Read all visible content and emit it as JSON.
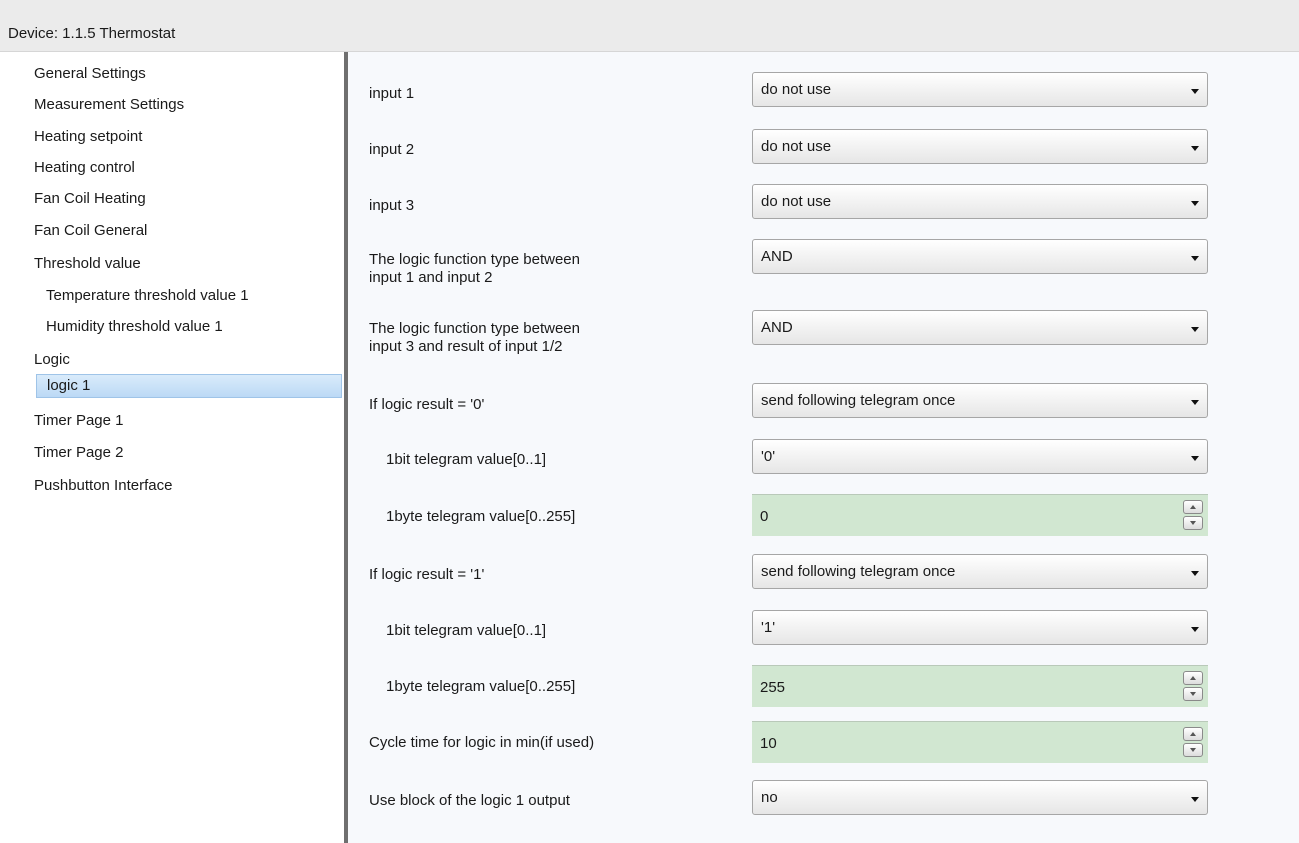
{
  "window": {
    "title": "Device: 1.1.5  Thermostat"
  },
  "sidebar": {
    "items": [
      {
        "label": "General Settings"
      },
      {
        "label": "Measurement Settings"
      },
      {
        "label": "Heating setpoint"
      },
      {
        "label": "Heating control"
      },
      {
        "label": "Fan Coil Heating"
      },
      {
        "label": "Fan Coil General"
      },
      {
        "label": "Threshold value"
      },
      {
        "label": "Temperature threshold value 1"
      },
      {
        "label": "Humidity threshold value 1"
      },
      {
        "label": "Logic"
      },
      {
        "label": "logic 1",
        "selected": true
      },
      {
        "label": "Timer Page 1"
      },
      {
        "label": "Timer Page 2"
      },
      {
        "label": "Pushbutton Interface"
      }
    ]
  },
  "params": {
    "input1": {
      "label": "input 1",
      "value": "do not use"
    },
    "input2": {
      "label": "input 2",
      "value": "do not use"
    },
    "input3": {
      "label": "input 3",
      "value": "do not use"
    },
    "logic12": {
      "label_line1": "The logic function type between",
      "label_line2": "input 1 and input 2",
      "value": "AND"
    },
    "logic3": {
      "label_line1": "The logic function type between",
      "label_line2": "input 3 and result of  input 1/2",
      "value": "AND"
    },
    "result0": {
      "label": "If logic result = '0'",
      "value": "send following telegram once"
    },
    "bit0": {
      "label": "1bit telegram value[0..1]",
      "value": "'0'"
    },
    "byte0": {
      "label": "1byte telegram value[0..255]",
      "value": "0"
    },
    "result1": {
      "label": "If logic result = '1'",
      "value": "send following telegram once"
    },
    "bit1": {
      "label": "1bit telegram value[0..1]",
      "value": "'1'"
    },
    "byte1": {
      "label": "1byte telegram value[0..255]",
      "value": "255"
    },
    "cycle": {
      "label": "Cycle time for logic in min(if used)",
      "value": "10"
    },
    "block": {
      "label": "Use block of the logic 1 output",
      "value": "no"
    }
  }
}
